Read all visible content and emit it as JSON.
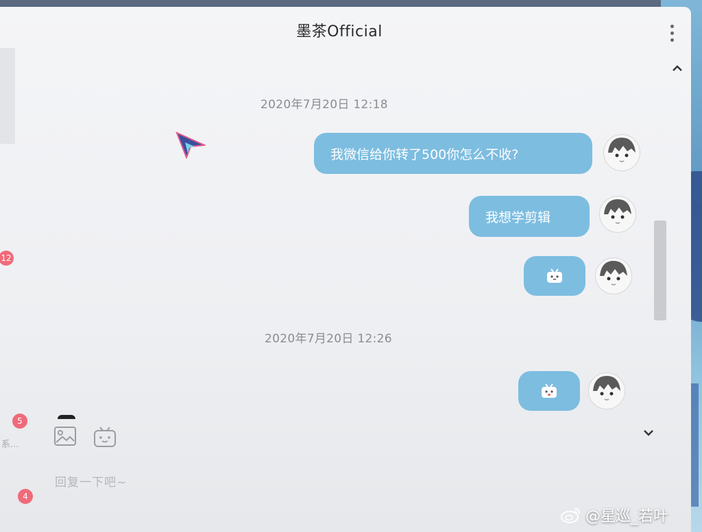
{
  "window": {
    "title": "墨茶Official"
  },
  "messages": [
    {
      "type": "timestamp",
      "text": "2020年7月20日 12:18"
    },
    {
      "type": "text",
      "text": "我微信给你转了500你怎么不收?"
    },
    {
      "type": "text",
      "text": "我想学剪辑"
    },
    {
      "type": "sticker",
      "icon": "bilibili-tv-face-icon"
    },
    {
      "type": "timestamp",
      "text": "2020年7月20日 12:26"
    },
    {
      "type": "sticker",
      "icon": "bilibili-tv-face-icon"
    }
  ],
  "sidebar": {
    "badges": [
      "12",
      "5",
      "4"
    ],
    "snippet": "系..."
  },
  "composer": {
    "placeholder": "回复一下吧~",
    "tools": [
      "image-icon",
      "emoji-icon"
    ]
  },
  "watermark": {
    "text": "@星巡_若叶",
    "icon": "weibo-icon"
  },
  "colors": {
    "bubble": "#7dbde0",
    "badge": "#f06a7a",
    "background": "#f1f2f4"
  }
}
